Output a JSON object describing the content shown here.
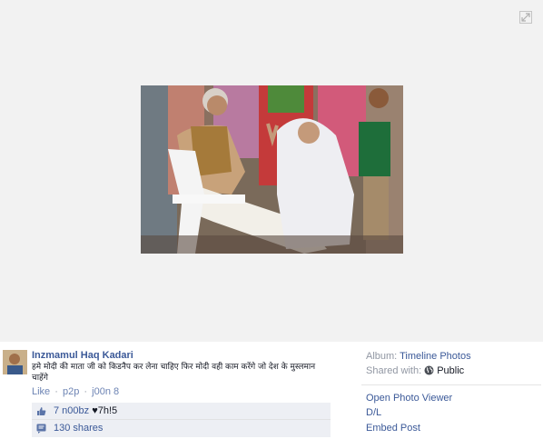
{
  "post": {
    "author": "Inzmamul Haq Kadari",
    "text": "हमे मोदी की माता जी को किडनैप कर लेना चाहिए फिर मोदी वही काम करेंगे जो देश के मुस्लमान चाहेंगे",
    "actions": {
      "like": "Like",
      "sep": "·",
      "p2p": "p2p",
      "time": "j00n 8"
    },
    "likes_text": "7 n00bz",
    "heart": "♥",
    "likes_extra": "7h!5",
    "shares_text": "130 shares"
  },
  "sidebar": {
    "album_label": "Album:",
    "album_value": "Timeline Photos",
    "shared_label": "Shared with:",
    "shared_value": "Public",
    "links": [
      "Open Photo Viewer",
      "D/L",
      "Embed Post"
    ]
  },
  "icons": {
    "expand": "expand-icon",
    "thumb": "thumbs-up-icon",
    "share": "share-icon",
    "globe": "globe-icon"
  },
  "colors": {
    "link": "#3b5998",
    "muted": "#9197a3",
    "stage": "#f2f2f2",
    "ufi_bg": "#edeff4"
  }
}
